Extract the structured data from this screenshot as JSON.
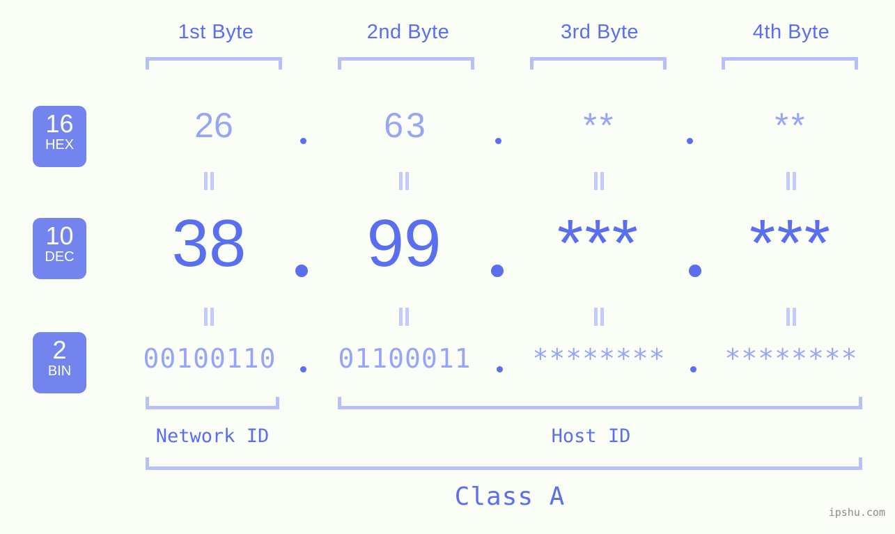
{
  "page": {
    "background_color": "#fbfdf7",
    "accent_color": "#5a6ef0",
    "accent_light_color": "#97a5f7",
    "bracket_color": "#b6c0fb",
    "badge_color": "#7484ef"
  },
  "headers": [
    {
      "label": "1st Byte"
    },
    {
      "label": "2nd Byte"
    },
    {
      "label": "3rd Byte"
    },
    {
      "label": "4th Byte"
    }
  ],
  "bases": [
    {
      "number": "16",
      "name": "HEX"
    },
    {
      "number": "10",
      "name": "DEC"
    },
    {
      "number": "2",
      "name": "BIN"
    }
  ],
  "rows": {
    "hex": {
      "b1": "26",
      "b2": "63",
      "b3": "**",
      "b4": "**"
    },
    "dec": {
      "b1": "38",
      "b2": "99",
      "b3": "***",
      "b4": "***"
    },
    "bin": {
      "b1": "00100110",
      "b2": "01100011",
      "b3": "********",
      "b4": "********"
    }
  },
  "separators": {
    "dot": ".",
    "equals": "="
  },
  "footer": {
    "network_id": "Network ID",
    "host_id": "Host ID",
    "class": "Class A",
    "watermark": "ipshu.com"
  }
}
